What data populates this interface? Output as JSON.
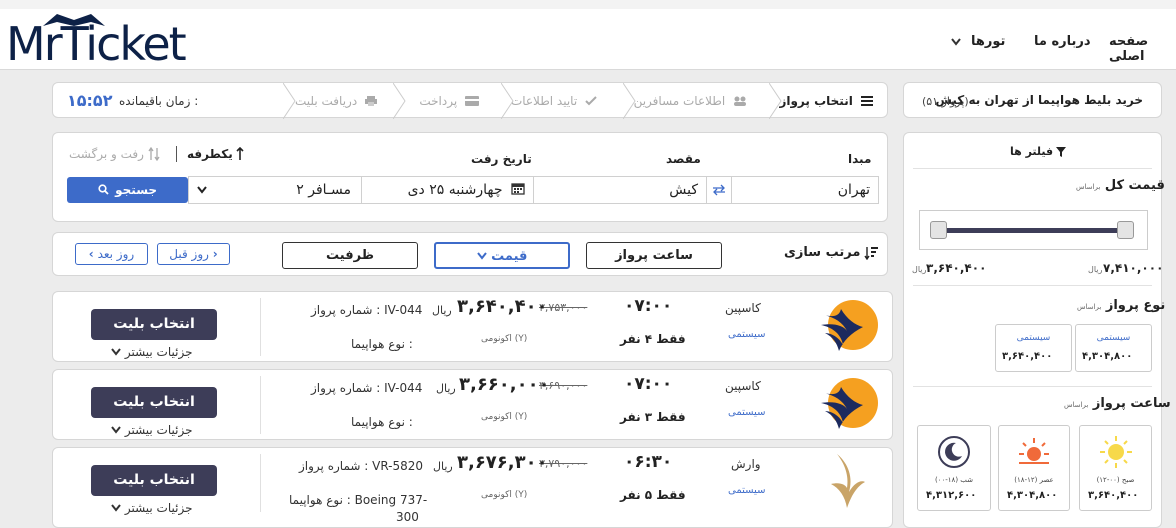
{
  "logo": {
    "text": "MrTicket"
  },
  "nav": {
    "home": "صفحه اصلی",
    "about": "درباره ما",
    "tours": "تورها"
  },
  "header": {
    "title": "خرید بلیط هواپیما از تهران به کیش",
    "count": "(۵۱ پرواز)"
  },
  "timer": {
    "label": "زمان باقیمانده :",
    "value": "۱۵:۵۲"
  },
  "steps": [
    "انتخاب پرواز",
    "اطلاعات مسافرین",
    "تایید اطلاعات",
    "پرداخت",
    "دریافت بلیت"
  ],
  "search": {
    "trip_oneway": "یکطرفه",
    "trip_round": "رفت و برگشت",
    "origin_label": "مبدا",
    "dest_label": "مقصد",
    "date_label": "تاریخ رفت",
    "origin": "تهران",
    "dest": "کیش",
    "date": "چهارشنبه ۲۵ دی",
    "passengers": "۲ مسـافر",
    "search_btn": "جستجو"
  },
  "sort": {
    "label": "مرتب سازی",
    "flight_time": "ساعت پرواز",
    "price": "قیمت",
    "capacity": "ظرفیت",
    "prev_day": "روز قبل",
    "next_day": "روز بعد"
  },
  "flights": [
    {
      "airline": "کاسپین",
      "type": "سیستمی",
      "time": "۰۷:۰۰",
      "seats": "فقط ۴ نفر",
      "price": "۳,۶۴۰,۴۰۰",
      "old_price": "۳,۷۵۳,۰۰۰",
      "currency": "ریال",
      "class": "اکونومی (Y)",
      "flight_no": "شماره پرواز : IV-044",
      "aircraft": "نوع هواپیما :",
      "select": "انتخاب بلیت",
      "more": "جزئیات بیشتر"
    },
    {
      "airline": "کاسپین",
      "type": "سیستمی",
      "time": "۰۷:۰۰",
      "seats": "فقط ۳ نفر",
      "price": "۳,۶۶۰,۰۰۰",
      "old_price": "۳,۶۹۰,۰۰۰",
      "currency": "ریال",
      "class": "اکونومی (Y)",
      "flight_no": "شماره پرواز : IV-044",
      "aircraft": "نوع هواپیما :",
      "select": "انتخاب بلیت",
      "more": "جزئیات بیشتر"
    },
    {
      "airline": "وارش",
      "type": "سیستمی",
      "time": "۰۶:۳۰",
      "seats": "فقط ۵ نفر",
      "price": "۳,۶۷۶,۳۰۰",
      "old_price": "۳,۷۹۰,۰۰۰",
      "currency": "ریال",
      "class": "اکونومی (Y)",
      "flight_no": "شماره پرواز : VR-5820",
      "aircraft": "نوع هواپیما : Boeing 737-",
      "aircraft2": "300",
      "select": "انتخاب بلیت",
      "more": "جزئیات بیشتر"
    }
  ],
  "filters": {
    "title": "فیلتر ها",
    "basis": "براساس",
    "total_price": "قیمت کل",
    "price_min": "۳,۶۴۰,۴۰۰",
    "price_max": "۷,۴۱۰,۰۰۰",
    "currency_short": "ریال",
    "flight_type": "نوع پرواز",
    "type_boxes": [
      {
        "label": "سیستمی",
        "price": "۴,۳۰۴,۸۰۰"
      },
      {
        "label": "سیستمی",
        "price": "۳,۶۴۰,۴۰۰"
      }
    ],
    "flight_time": "ساعت پرواز",
    "time_boxes": [
      {
        "label": "صبح (۰۰-۱۲)",
        "price": "۳,۶۴۰,۴۰۰"
      },
      {
        "label": "عصر (۱۲-۱۸)",
        "price": "۴,۳۰۴,۸۰۰"
      },
      {
        "label": "شب (۱۸-۰۰)",
        "price": "۴,۳۱۲,۶۰۰"
      }
    ]
  },
  "colors": {
    "accent": "#3d6bc9",
    "dark": "#3d3d58",
    "navy": "#0d2147",
    "orange": "#f5a020"
  }
}
